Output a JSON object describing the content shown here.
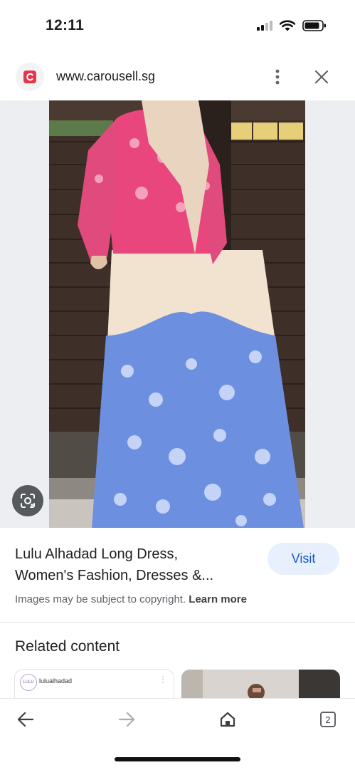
{
  "status_bar": {
    "time": "12:11",
    "icons": [
      "cellular-signal-icon",
      "wifi-icon",
      "battery-icon"
    ]
  },
  "browser": {
    "url": "www.carousell.sg",
    "site_icon": "carousell-logo-icon",
    "accent_color": "#e6344a"
  },
  "result": {
    "title_line1": "Lulu Alhadad Long Dress,",
    "title_line2": "Women's Fashion, Dresses &...",
    "visit_label": "Visit",
    "copyright_text": "Images may be subject to copyright.",
    "learn_more_label": "Learn more"
  },
  "related": {
    "heading": "Related content",
    "cards": [
      {
        "username": "lulualhadad",
        "avatar_text": "LULU"
      }
    ]
  },
  "bottom_nav": {
    "tab_count": "2",
    "icons": [
      "back-arrow-icon",
      "forward-arrow-icon",
      "home-icon",
      "tabs-icon"
    ]
  }
}
